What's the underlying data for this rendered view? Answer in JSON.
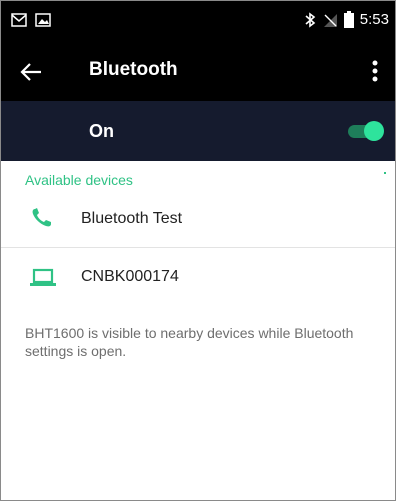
{
  "status_bar": {
    "time": "5:53",
    "icons": [
      "gmail-icon",
      "image-icon",
      "bluetooth-icon",
      "no-signal-icon",
      "battery-icon"
    ]
  },
  "toolbar": {
    "title": "Bluetooth",
    "icons": [
      "back-arrow-icon",
      "overflow-menu-icon"
    ]
  },
  "bluetooth_switch": {
    "label": "On",
    "state": "on"
  },
  "available_devices": {
    "header": "Available devices",
    "devices": [
      {
        "name": "Bluetooth Test",
        "icon": "phone-icon"
      },
      {
        "name": "CNBK000174",
        "icon": "laptop-icon"
      }
    ]
  },
  "info_text": "BHT1600 is visible to nearby devices while Bluetooth settings is open.",
  "colors": {
    "accent": "#2fc285",
    "switch_bar": "#151b2e",
    "toolbar": "#000000"
  }
}
